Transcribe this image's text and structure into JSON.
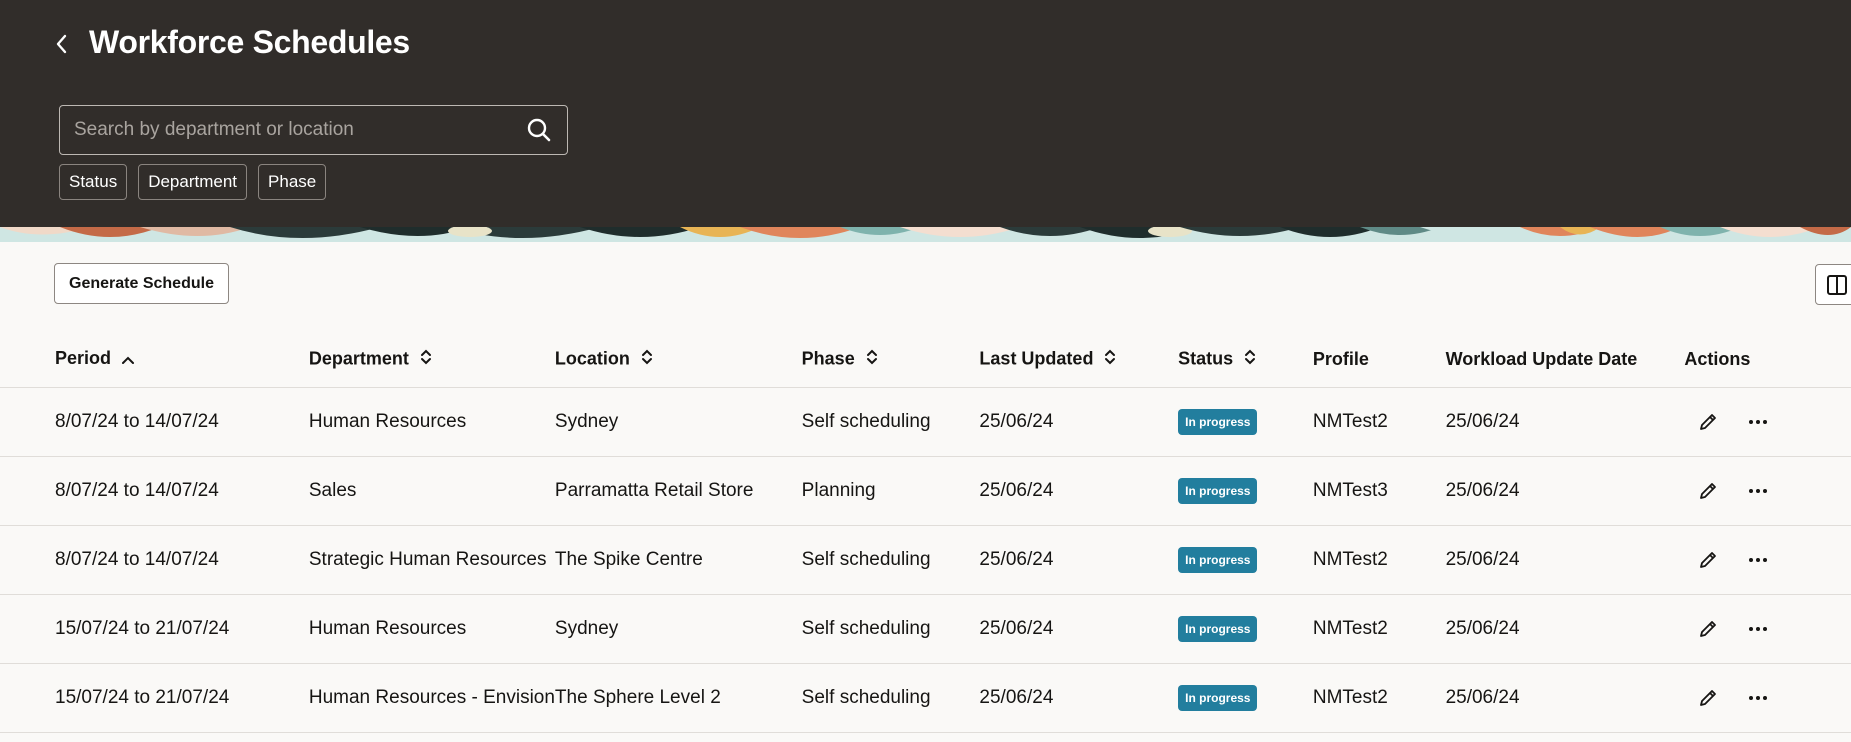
{
  "header": {
    "title": "Workforce Schedules",
    "search_placeholder": "Search by department or location",
    "filters": [
      "Status",
      "Department",
      "Phase"
    ]
  },
  "toolbar": {
    "generate_label": "Generate Schedule"
  },
  "table": {
    "columns": {
      "period": "Period",
      "department": "Department",
      "location": "Location",
      "phase": "Phase",
      "last_updated": "Last Updated",
      "status": "Status",
      "profile": "Profile",
      "workload": "Workload Update Date",
      "actions": "Actions"
    },
    "sorted_column": "period",
    "sort_direction": "ascending",
    "rows": [
      {
        "period": "8/07/24 to 14/07/24",
        "department": "Human Resources",
        "location": "Sydney",
        "phase": "Self scheduling",
        "last_updated": "25/06/24",
        "status": "In progress",
        "profile": "NMTest2",
        "workload": "25/06/24"
      },
      {
        "period": "8/07/24 to 14/07/24",
        "department": "Sales",
        "location": "Parramatta Retail Store",
        "phase": "Planning",
        "last_updated": "25/06/24",
        "status": "In progress",
        "profile": "NMTest3",
        "workload": "25/06/24"
      },
      {
        "period": "8/07/24 to 14/07/24",
        "department": "Strategic Human Resources",
        "location": "The Spike Centre",
        "phase": "Self scheduling",
        "last_updated": "25/06/24",
        "status": "In progress",
        "profile": "NMTest2",
        "workload": "25/06/24"
      },
      {
        "period": "15/07/24 to 21/07/24",
        "department": "Human Resources",
        "location": "Sydney",
        "phase": "Self scheduling",
        "last_updated": "25/06/24",
        "status": "In progress",
        "profile": "NMTest2",
        "workload": "25/06/24"
      },
      {
        "period": "15/07/24 to 21/07/24",
        "department": "Human Resources - Envision",
        "location": "The Sphere Level 2",
        "phase": "Self scheduling",
        "last_updated": "25/06/24",
        "status": "In progress",
        "profile": "NMTest2",
        "workload": "25/06/24"
      }
    ]
  },
  "colors": {
    "header_bg": "#312d2a",
    "status_badge": "#227e9e",
    "page_bg": "#faf9f7"
  },
  "icons": [
    "back-chevron-icon",
    "search-icon",
    "sort-ascending-icon",
    "sort-icon",
    "edit-pencil-icon",
    "more-horizontal-icon",
    "column-layout-icon"
  ]
}
